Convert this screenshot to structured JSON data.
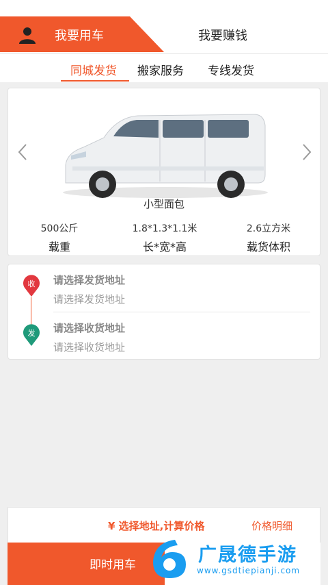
{
  "top_tabs": {
    "user_role": "我要用车",
    "driver_role": "我要赚钱"
  },
  "sub_tabs": [
    {
      "label": "同城发货",
      "active": true
    },
    {
      "label": "搬家服务",
      "active": false
    },
    {
      "label": "专线发货",
      "active": false
    }
  ],
  "vehicle": {
    "name": "小型面包",
    "specs": [
      {
        "value": "500公斤",
        "label": "载重"
      },
      {
        "value": "1.8*1.3*1.1米",
        "label": "长*宽*高"
      },
      {
        "value": "2.6立方米",
        "label": "载货体积"
      }
    ]
  },
  "address": {
    "pickup_badge": "收",
    "pickup_title": "请选择发货地址",
    "pickup_placeholder": "请选择发货地址",
    "delivery_badge": "发",
    "delivery_title": "请选择收货地址",
    "delivery_placeholder": "请选择收货地址"
  },
  "bottom": {
    "calc_hint": "¥ 选择地址,计算价格",
    "price_detail": "价格明细",
    "order_button": "即时用车"
  },
  "watermark": {
    "title": "广晟德手游",
    "url": "www.gsdtiepianji.com"
  },
  "colors": {
    "accent": "#f0582c",
    "pickup_pin": "#e2383f",
    "delivery_pin": "#1f9a7a",
    "watermark": "#1a9df0"
  }
}
